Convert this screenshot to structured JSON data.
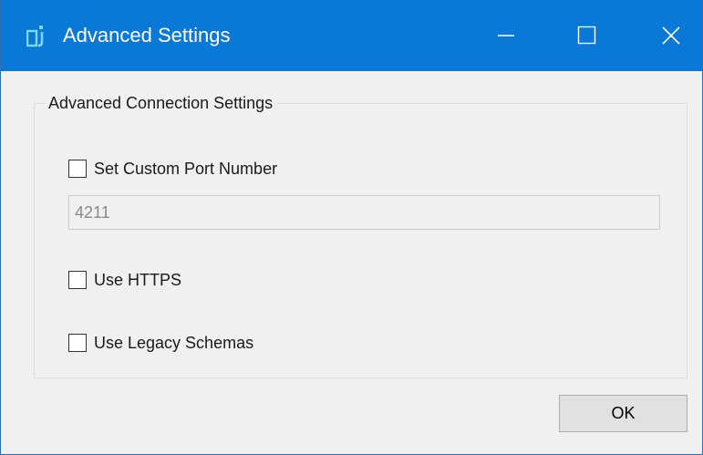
{
  "window": {
    "title": "Advanced Settings",
    "controls": {
      "minimize": "minimize-icon",
      "maximize": "maximize-icon",
      "close": "close-icon"
    },
    "titlebar_color": "#0a78d7"
  },
  "group": {
    "title": "Advanced Connection Settings",
    "custom_port": {
      "label": "Set Custom Port Number",
      "checked": false
    },
    "port_field": {
      "value": "4211",
      "enabled": false
    },
    "https": {
      "label": "Use HTTPS",
      "checked": false
    },
    "legacy_schemas": {
      "label": "Use Legacy Schemas",
      "checked": false
    }
  },
  "footer": {
    "ok_label": "OK"
  }
}
